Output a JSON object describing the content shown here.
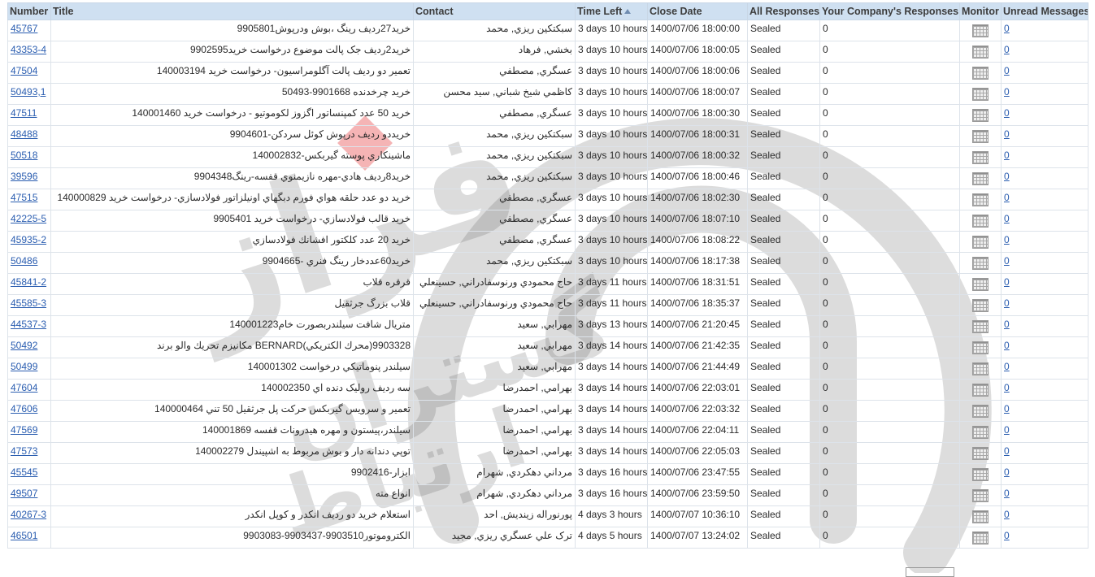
{
  "columns": {
    "number": "Number",
    "title": "Title",
    "contact": "Contact",
    "time_left": "Time Left",
    "close_date": "Close Date",
    "all_responses": "All Responses",
    "company_responses": "Your Company's Responses",
    "monitor": "Monitor",
    "unread": "Unread Messages"
  },
  "sort": {
    "column": "time_left",
    "direction": "ascending",
    "icon": "sort-ascending-icon"
  },
  "rows": [
    {
      "number": "45767",
      "title": "خريد27رديف رينگ ،بوش ودرپوش9905801",
      "contact": "سبكتكين ريزي, محمد",
      "time_left": "3 days 10 hours",
      "close_date": "1400/07/06 18:00:00",
      "all_responses": "Sealed",
      "company_responses": "0",
      "unread": "0"
    },
    {
      "number": "43353-4",
      "title": "خريد2رديف جک پالت موضوع درخواست خريد9902595",
      "contact": "بخشي, فرهاد",
      "time_left": "3 days 10 hours",
      "close_date": "1400/07/06 18:00:05",
      "all_responses": "Sealed",
      "company_responses": "0",
      "unread": "0"
    },
    {
      "number": "47504",
      "title": "تعمير دو رديف پالت آگلومراسيون- درخواست خريد 140003194",
      "contact": "عسگري, مصطفي",
      "time_left": "3 days 10 hours",
      "close_date": "1400/07/06 18:00:06",
      "all_responses": "Sealed",
      "company_responses": "0",
      "unread": "0"
    },
    {
      "number": "50493,1",
      "title": "خريد چرخدنده 9901668-50493",
      "contact": "كاظمي شيخ شباني, سيد محسن",
      "time_left": "3 days 10 hours",
      "close_date": "1400/07/06 18:00:07",
      "all_responses": "Sealed",
      "company_responses": "0",
      "unread": "0"
    },
    {
      "number": "47511",
      "title": "خريد 50 عدد كمپنساتور اگزوز لكوموتيو - درخواست خريد 140001460",
      "contact": "عسگري, مصطفي",
      "time_left": "3 days 10 hours",
      "close_date": "1400/07/06 18:00:30",
      "all_responses": "Sealed",
      "company_responses": "0",
      "unread": "0"
    },
    {
      "number": "48488",
      "title": "خريددو رديف درپوش كوئل سردكن-9904601",
      "contact": "سبكتكين ريزي, محمد",
      "time_left": "3 days 10 hours",
      "close_date": "1400/07/06 18:00:31",
      "all_responses": "Sealed",
      "company_responses": "0",
      "unread": "0"
    },
    {
      "number": "50518",
      "title": "ماشينكاري پوسته گيربكس-140002832",
      "contact": "سبكتكين ريزي, محمد",
      "time_left": "3 days 10 hours",
      "close_date": "1400/07/06 18:00:32",
      "all_responses": "Sealed",
      "company_responses": "0",
      "unread": "0"
    },
    {
      "number": "39596",
      "title": "خريد8رديف هادي-مهره نازيمنوي قفسه-رينگ9904348",
      "contact": "سبكتكين ريزي, محمد",
      "time_left": "3 days 10 hours",
      "close_date": "1400/07/06 18:00:46",
      "all_responses": "Sealed",
      "company_responses": "0",
      "unread": "0"
    },
    {
      "number": "47515",
      "title": "خريد دو عدد حلقه هواي فورم دبگهاي اونيلزاتور فولادسازي- درخواست خريد 140000829",
      "contact": "عسگري, مصطفي",
      "time_left": "3 days 10 hours",
      "close_date": "1400/07/06 18:02:30",
      "all_responses": "Sealed",
      "company_responses": "0",
      "unread": "0"
    },
    {
      "number": "42225-5",
      "title": "خريد قالب فولادسازي- درخواست خريد 9905401",
      "contact": "عسگري, مصطفي",
      "time_left": "3 days 10 hours",
      "close_date": "1400/07/06 18:07:10",
      "all_responses": "Sealed",
      "company_responses": "0",
      "unread": "0"
    },
    {
      "number": "45935-2",
      "title": "خريد 20 عدد كلكتور افشانك فولادسازي",
      "contact": "عسگري, مصطفي",
      "time_left": "3 days 10 hours",
      "close_date": "1400/07/06 18:08:22",
      "all_responses": "Sealed",
      "company_responses": "0",
      "unread": "0"
    },
    {
      "number": "50486",
      "title": "خريد60عددخار رينگ فنري -9904665",
      "contact": "سبكتكين ريزي, محمد",
      "time_left": "3 days 10 hours",
      "close_date": "1400/07/06 18:17:38",
      "all_responses": "Sealed",
      "company_responses": "0",
      "unread": "0"
    },
    {
      "number": "45841-2",
      "title": "قرقره قلاب",
      "contact": "حاج محمودي ورنوسفادراني, حسينعلي",
      "time_left": "3 days 11 hours",
      "close_date": "1400/07/06 18:31:51",
      "all_responses": "Sealed",
      "company_responses": "0",
      "unread": "0"
    },
    {
      "number": "45585-3",
      "title": "قلاب بزرگ جرثقيل",
      "contact": "حاج محمودي ورنوسفادراني, حسينعلي",
      "time_left": "3 days 11 hours",
      "close_date": "1400/07/06 18:35:37",
      "all_responses": "Sealed",
      "company_responses": "0",
      "unread": "0"
    },
    {
      "number": "44537-3",
      "title": "متريال شافت سيلندربصورت خام140001223",
      "contact": "مهرابي, سعيد",
      "time_left": "3 days 13 hours",
      "close_date": "1400/07/06 21:20:45",
      "all_responses": "Sealed",
      "company_responses": "0",
      "unread": "0"
    },
    {
      "number": "50492",
      "title": "9903328(محرك الكتريكي)BERNARD مكانيزم تحريك والو برند",
      "contact": "مهرابي, سعيد",
      "time_left": "3 days 14 hours",
      "close_date": "1400/07/06 21:42:35",
      "all_responses": "Sealed",
      "company_responses": "0",
      "unread": "0"
    },
    {
      "number": "50499",
      "title": "سيلندر پنوماتيكي درخواست 140001302",
      "contact": "مهرابي, سعيد",
      "time_left": "3 days 14 hours",
      "close_date": "1400/07/06 21:44:49",
      "all_responses": "Sealed",
      "company_responses": "0",
      "unread": "0"
    },
    {
      "number": "47604",
      "title": "سه رديف روليک دنده اي 140002350",
      "contact": "بهرامي, احمدرضا",
      "time_left": "3 days 14 hours",
      "close_date": "1400/07/06 22:03:01",
      "all_responses": "Sealed",
      "company_responses": "0",
      "unread": "0"
    },
    {
      "number": "47606",
      "title": "تعمير و سرويس گيربكس حركت پل جرثقيل 50 تني 140000464",
      "contact": "بهرامي, احمدرضا",
      "time_left": "3 days 14 hours",
      "close_date": "1400/07/06 22:03:32",
      "all_responses": "Sealed",
      "company_responses": "0",
      "unread": "0"
    },
    {
      "number": "47569",
      "title": "سيلندر،پيستون و مهره هيدرونات قفسه 140001869",
      "contact": "بهرامي, احمدرضا",
      "time_left": "3 days 14 hours",
      "close_date": "1400/07/06 22:04:11",
      "all_responses": "Sealed",
      "company_responses": "0",
      "unread": "0"
    },
    {
      "number": "47573",
      "title": "توپي دندانه دار و بوش مربوط به اشپيندل 140002279",
      "contact": "بهرامي, احمدرضا",
      "time_left": "3 days 14 hours",
      "close_date": "1400/07/06 22:05:03",
      "all_responses": "Sealed",
      "company_responses": "0",
      "unread": "0"
    },
    {
      "number": "45545",
      "title": "ابزار-9902416",
      "contact": "مرداني دهكردي, شهرام",
      "time_left": "3 days 16 hours",
      "close_date": "1400/07/06 23:47:55",
      "all_responses": "Sealed",
      "company_responses": "0",
      "unread": "0"
    },
    {
      "number": "49507",
      "title": "انواع مته",
      "contact": "مرداني دهكردي, شهرام",
      "time_left": "3 days 16 hours",
      "close_date": "1400/07/06 23:59:50",
      "all_responses": "Sealed",
      "company_responses": "0",
      "unread": "0"
    },
    {
      "number": "40267-3",
      "title": "استعلام خريد دو رديف انكدر و كوپل انكدر",
      "contact": "پورنوراله زينديش, احد",
      "time_left": "4 days 3 hours",
      "close_date": "1400/07/07 10:36:10",
      "all_responses": "Sealed",
      "company_responses": "0",
      "unread": "0"
    },
    {
      "number": "46501",
      "title": "الكتروموتور9903510-9903437-9903083",
      "contact": "ترک علي عسگري ريزي, مجيد",
      "time_left": "4 days 5 hours",
      "close_date": "1400/07/07 13:24:02",
      "all_responses": "Sealed",
      "company_responses": "0",
      "unread": "0"
    }
  ],
  "monitor_icon": "monitor-grid-icon",
  "watermark": {
    "icon": "company-logo-watermark",
    "text_main": "فراز",
    "text_sub": "گستران",
    "text_sub2": "ارتباط",
    "accent_color": "#e8595b",
    "shape_color": "#555555"
  }
}
